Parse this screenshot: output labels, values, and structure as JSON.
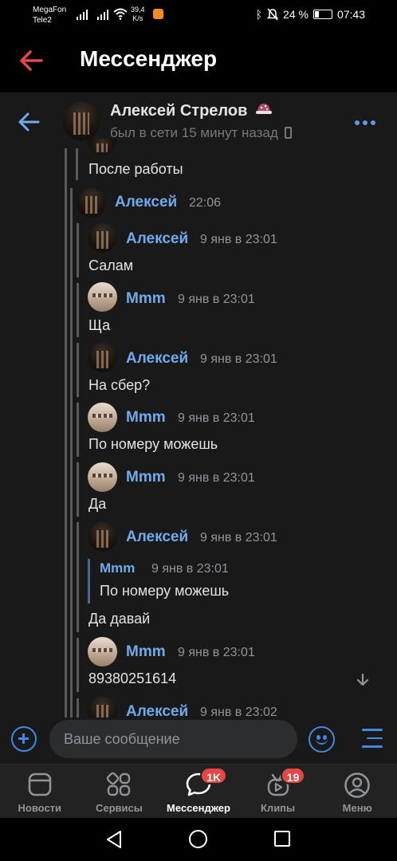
{
  "status_bar": {
    "carrier_1": "MegaFon",
    "carrier_2": "Tele2",
    "net_speed_value": "39,4",
    "net_speed_unit": "K/s",
    "battery": "24 %",
    "battery_level": 0.24,
    "time": "07:43"
  },
  "app_header": {
    "title": "Мессенджер"
  },
  "chat_header": {
    "name": "Алексей Стрелов",
    "status": "был в сети 15 минут назад"
  },
  "messages": {
    "top_fragment_text": "После работы",
    "forward_sender": "Алексей",
    "forward_time": "22:06",
    "items": [
      {
        "sender": "Алексей",
        "time": "9 янв в 23:01",
        "text": "Салам"
      },
      {
        "sender": "Mmm",
        "time": "9 янв в 23:01",
        "text": "Ща"
      },
      {
        "sender": "Алексей",
        "time": "9 янв в 23:01",
        "text": "На сбер?"
      },
      {
        "sender": "Mmm",
        "time": "9 янв в 23:01",
        "text": "По номеру можешь"
      },
      {
        "sender": "Mmm",
        "time": "9 янв в 23:01",
        "text": "Да"
      },
      {
        "sender": "Алексей",
        "time": "9 янв в 23:01",
        "text": "Да давай",
        "quote": {
          "sender": "Mmm",
          "time": "9 янв в 23:01",
          "text": "По номеру можешь"
        }
      },
      {
        "sender": "Mmm",
        "time": "9 янв в 23:01",
        "text": "89380251614"
      },
      {
        "sender": "Алексей",
        "time": "9 янв в 23:02",
        "text": ""
      }
    ]
  },
  "composer": {
    "placeholder": "Ваше сообщение"
  },
  "tabs": [
    {
      "label": "Новости",
      "icon": "news-icon"
    },
    {
      "label": "Сервисы",
      "icon": "services-icon"
    },
    {
      "label": "Мессенджер",
      "icon": "messenger-icon",
      "badge": "1K",
      "active": true
    },
    {
      "label": "Клипы",
      "icon": "clips-icon",
      "badge": "19"
    },
    {
      "label": "Меню",
      "icon": "profile-icon"
    }
  ],
  "colors": {
    "accent": "#71aaeb",
    "button": "#3f8ae0",
    "badge": "#e64646",
    "back_arrow_header": "#e64646",
    "panel_bg": "#19191a"
  }
}
